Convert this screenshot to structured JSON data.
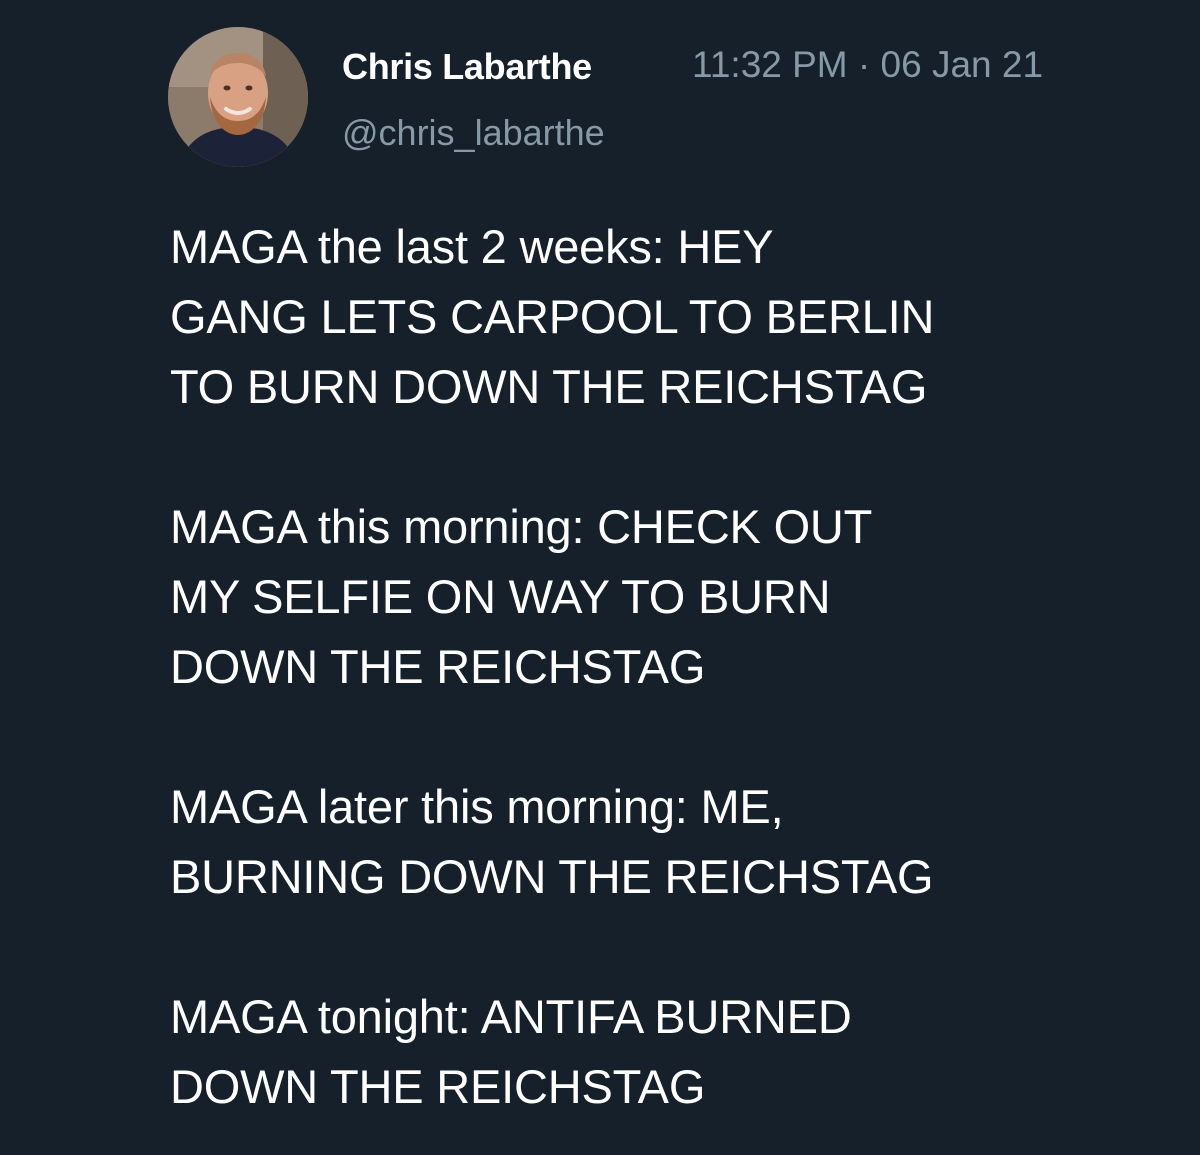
{
  "tweet": {
    "display_name": "Chris Labarthe",
    "handle": "@chris_labarthe",
    "timestamp": "11:32 PM · 06 Jan 21",
    "avatar_icon": "profile-photo",
    "paragraphs": [
      [
        "MAGA the last 2 weeks: HEY",
        "GANG LETS CARPOOL TO BERLIN",
        "TO BURN DOWN THE REICHSTAG"
      ],
      [
        "MAGA this morning: CHECK OUT",
        "MY SELFIE ON WAY TO BURN",
        "DOWN THE REICHSTAG"
      ],
      [
        "MAGA later this morning: ME,",
        "BURNING DOWN THE REICHSTAG"
      ],
      [
        "MAGA tonight: ANTIFA BURNED",
        "DOWN THE REICHSTAG"
      ]
    ]
  },
  "colors": {
    "background": "#15202b",
    "primary_text": "#ffffff",
    "secondary_text": "#8899a6"
  }
}
